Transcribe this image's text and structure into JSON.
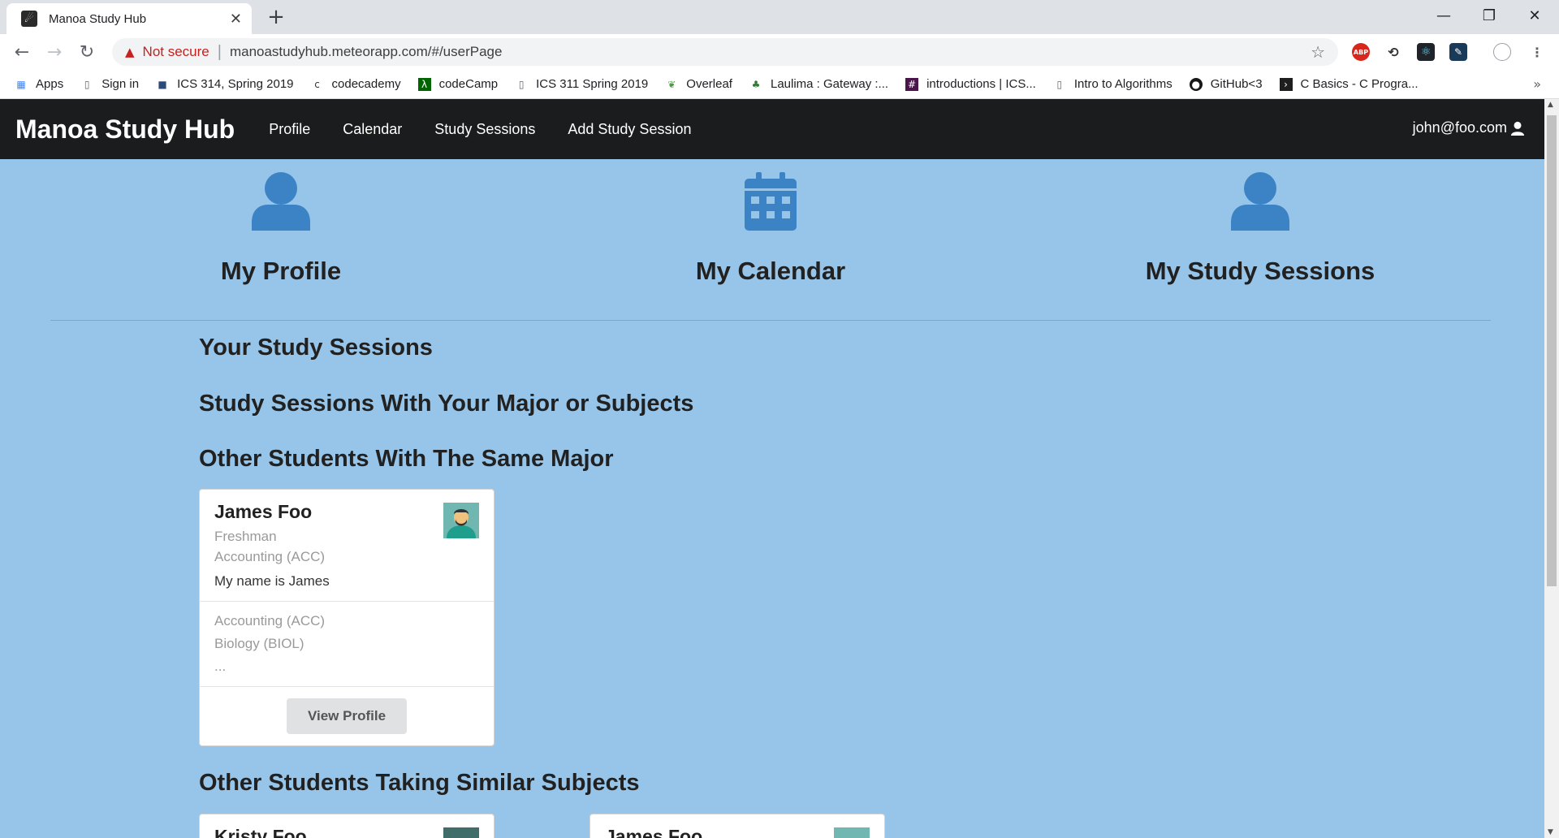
{
  "browser": {
    "tab_title": "Manoa Study Hub",
    "tab_icon": "meteor-favicon",
    "address_warning": "Not secure",
    "url": "manoastudyhub.meteorapp.com/#/userPage",
    "bookmarks": [
      {
        "label": "Apps",
        "icon": "apps-grid-icon"
      },
      {
        "label": "Sign in",
        "icon": "page-icon"
      },
      {
        "label": "ICS 314, Spring 2019",
        "icon": "square-icon"
      },
      {
        "label": "codecademy",
        "icon": "codecademy-icon"
      },
      {
        "label": "codeCamp",
        "icon": "codecamp-icon"
      },
      {
        "label": "ICS 311 Spring 2019",
        "icon": "page-icon"
      },
      {
        "label": "Overleaf",
        "icon": "leaf-icon"
      },
      {
        "label": "Laulima : Gateway :...",
        "icon": "laulima-icon"
      },
      {
        "label": "introductions | ICS...",
        "icon": "slack-icon"
      },
      {
        "label": "Intro to Algorithms",
        "icon": "page-icon"
      },
      {
        "label": "GitHub<3",
        "icon": "github-icon"
      },
      {
        "label": "C Basics - C Progra...",
        "icon": "terminal-icon"
      }
    ],
    "bookmark_more": "»"
  },
  "navbar": {
    "brand": "Manoa Study Hub",
    "items": [
      "Profile",
      "Calendar",
      "Study Sessions",
      "Add Study Session"
    ],
    "user": "john@foo.com"
  },
  "features": [
    {
      "label": "My Profile",
      "icon": "user-icon"
    },
    {
      "label": "My Calendar",
      "icon": "calendar-icon"
    },
    {
      "label": "My Study Sessions",
      "icon": "user-icon"
    }
  ],
  "sections": {
    "your_sessions": "Your Study Sessions",
    "major_sessions": "Study Sessions With Your Major or Subjects",
    "same_major": "Other Students With The Same Major",
    "similar_subjects": "Other Students Taking Similar Subjects"
  },
  "same_major_students": [
    {
      "name": "James Foo",
      "year": "Freshman",
      "major": "Accounting (ACC)",
      "description": "My name is James",
      "subjects": [
        "Accounting (ACC)",
        "Biology (BIOL)",
        "..."
      ],
      "button": "View Profile"
    }
  ],
  "similar_subject_students": [
    {
      "name": "Kristy Foo"
    },
    {
      "name": "James Foo"
    }
  ],
  "colors": {
    "page_background": "#97c5e9",
    "navbar": "#1b1c1d",
    "icon_blue": "#3b83c4"
  }
}
